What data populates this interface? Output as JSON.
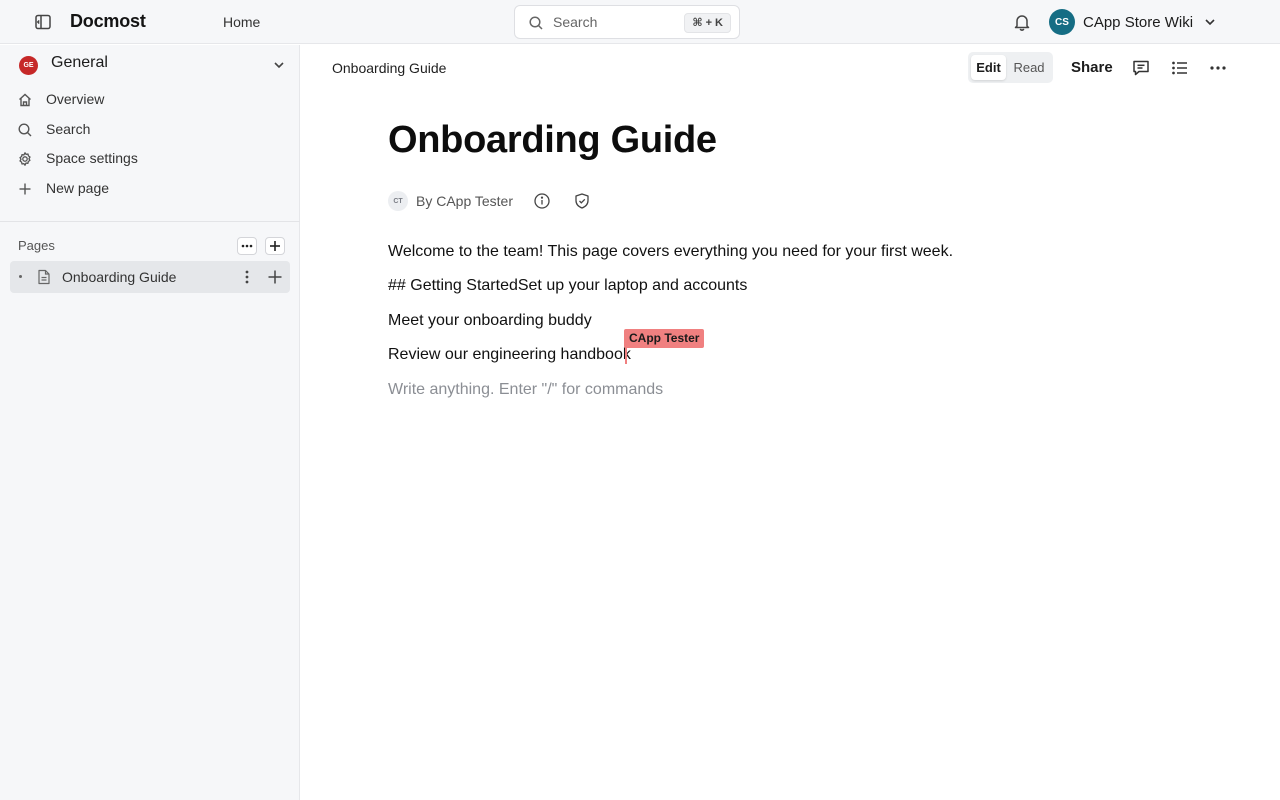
{
  "header": {
    "brand": "Docmost",
    "home_label": "Home",
    "search": {
      "label": "Search",
      "shortcut": "⌘ + K"
    },
    "workspace": {
      "initials": "CS",
      "name": "CApp Store Wiki",
      "avatar_color": "#156d84"
    }
  },
  "sidebar": {
    "space": {
      "initials": "GE",
      "name": "General",
      "avatar_color": "#c62828"
    },
    "items": [
      {
        "label": "Overview",
        "icon": "home-icon"
      },
      {
        "label": "Search",
        "icon": "search-icon"
      },
      {
        "label": "Space settings",
        "icon": "gear-icon"
      },
      {
        "label": "New page",
        "icon": "plus-icon"
      }
    ],
    "pages_label": "Pages",
    "pages": [
      {
        "label": "Onboarding Guide",
        "icon": "document-icon",
        "selected": true
      }
    ]
  },
  "main": {
    "breadcrumb": "Onboarding Guide",
    "mode": {
      "edit": "Edit",
      "read": "Read",
      "active": "Edit"
    },
    "share_label": "Share",
    "title": "Onboarding Guide",
    "author": {
      "initials": "CT",
      "by_line": "By CApp Tester"
    },
    "paragraphs": [
      "Welcome to the team! This page covers everything you need for your first week.",
      "## Getting StartedSet up your laptop and accounts",
      "Meet your onboarding buddy",
      "Review our engineering handbook"
    ],
    "placeholder": "Write anything. Enter \"/\" for commands",
    "collaborator": {
      "name": "CApp Tester",
      "color": "#f08080"
    }
  }
}
